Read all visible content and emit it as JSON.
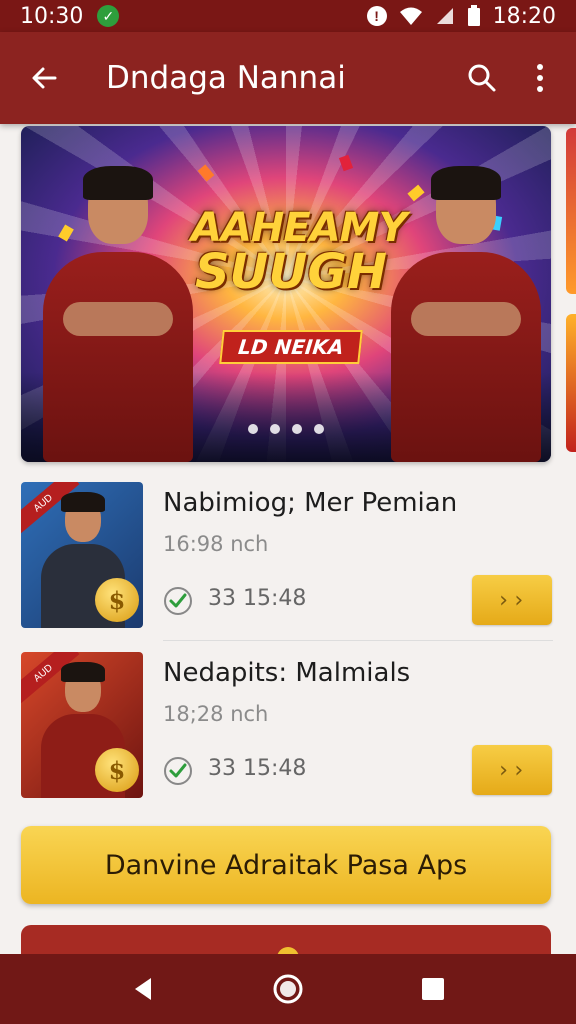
{
  "status_bar": {
    "time": "10:30",
    "clock": "18:20"
  },
  "app_bar": {
    "title": "Dndaga Nannai"
  },
  "banner": {
    "headline_line1": "AAHEAMY",
    "headline_line2": "SUUGH",
    "tag": "LD NEIKA",
    "slide_count": 4
  },
  "items": [
    {
      "name": "Nabimiog; Mer Pemian",
      "sub": "16:98 nch",
      "meta": "33  15:48",
      "go": "››",
      "badge": "AUD",
      "coin": "$"
    },
    {
      "name": "Nedapits: Malmials",
      "sub": "18;28 nch",
      "meta": "33  15:48",
      "go": "››",
      "badge": "AUD",
      "coin": "$"
    }
  ],
  "cta": {
    "label": "Danvine Adraitak Pasa Aps"
  },
  "colors": {
    "primary": "#8c2320",
    "status": "#7a1715",
    "accent": "#f0be30",
    "nav": "#711816"
  }
}
